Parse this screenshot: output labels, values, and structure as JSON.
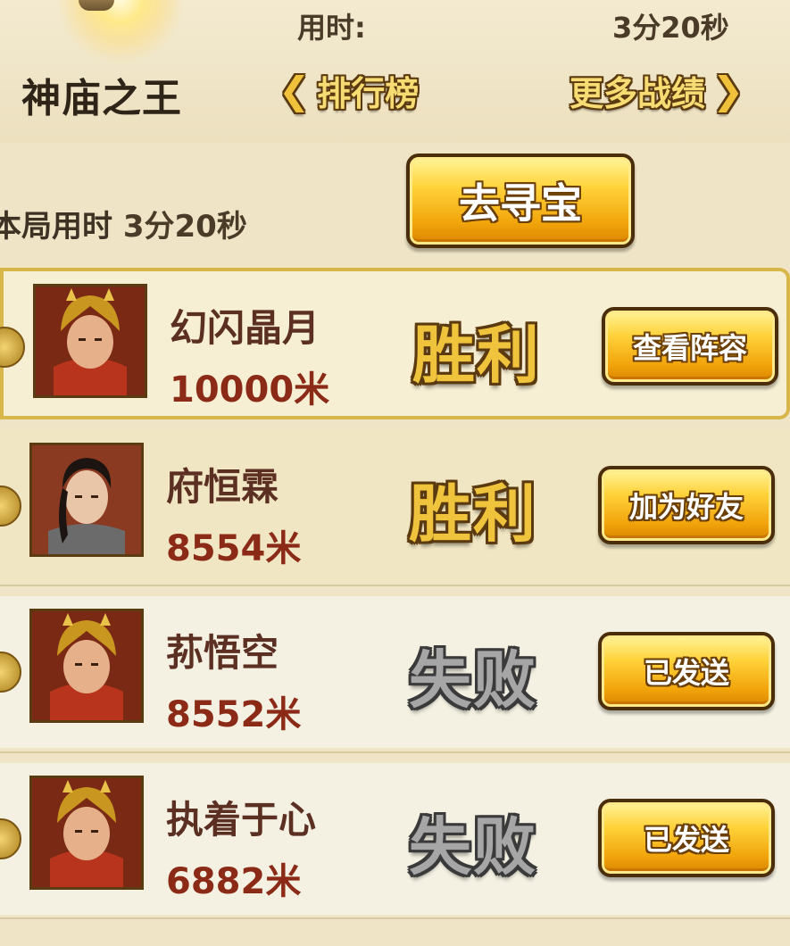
{
  "header": {
    "time_label": "用时:",
    "time_value": "3分20秒",
    "title": "神庙之王",
    "rank_tab": "排行榜",
    "more_tab": "更多战绩"
  },
  "summary": {
    "round_time_label": "本局用时",
    "round_time_value": "3分20秒",
    "treasure_button": "去寻宝"
  },
  "players": [
    {
      "name": "幻闪晶月",
      "distance": "10000米",
      "result": "胜利",
      "action": "查看阵容",
      "highlight": true
    },
    {
      "name": "府恒霖",
      "distance": "8554米",
      "result": "胜利",
      "action": "加为好友",
      "highlight": false
    },
    {
      "name": "荪悟空",
      "distance": "8552米",
      "result": "失败",
      "action": "已发送",
      "highlight": false
    },
    {
      "name": "执着于心",
      "distance": "6882米",
      "result": "失败",
      "action": "已发送",
      "highlight": false
    }
  ],
  "colors": {
    "background": "#efe4c6",
    "win_text": "#f0c33c",
    "lose_text": "#a6a6a6",
    "name_text": "#5b2f22",
    "distance_text": "#8b2a16",
    "button_gold": "#ffd23a"
  },
  "icons": {
    "rank_prev": "chevron-left-icon",
    "more_next": "chevron-right-icon",
    "medal": "medal-icon",
    "avatar": "hero-portrait"
  }
}
